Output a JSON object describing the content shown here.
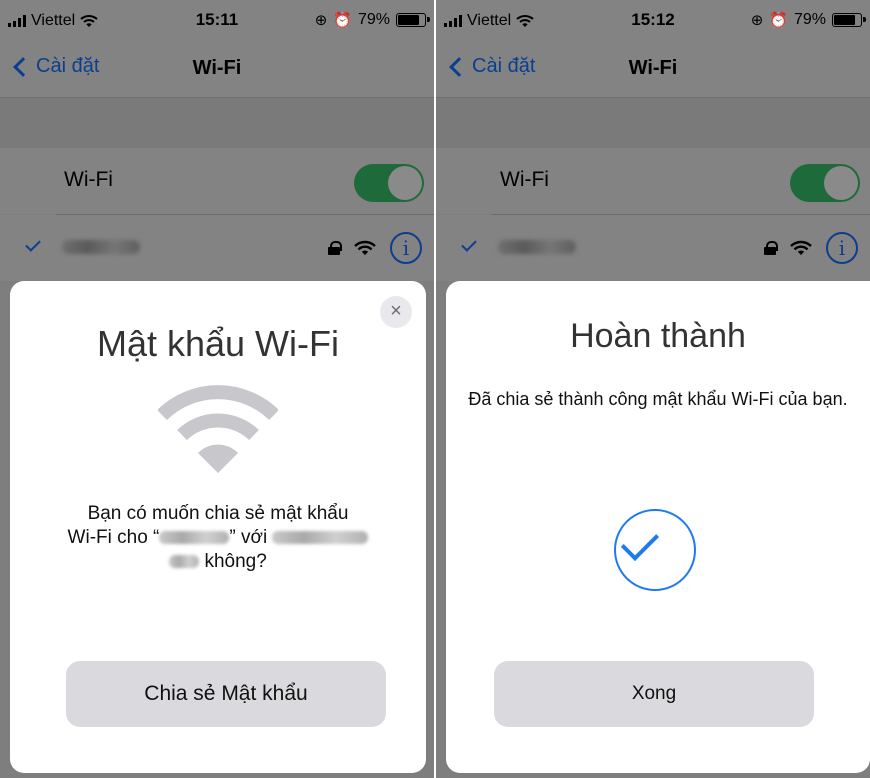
{
  "left": {
    "status": {
      "carrier": "Viettel",
      "time": "15:11",
      "battery": "79%"
    },
    "nav": {
      "back_label": "Cài đặt",
      "title": "Wi-Fi"
    },
    "wifi_row": {
      "label": "Wi-Fi",
      "toggle_on": true
    },
    "network_row": {
      "icon_lock": "lock-icon",
      "icon_wifi": "wifi-icon",
      "info_glyph": "i"
    },
    "sheet": {
      "close_glyph": "×",
      "heading": "Mật khẩu Wi-Fi",
      "body_line1": "Bạn có muốn chia sẻ mật khẩu",
      "body_line2_prefix": "Wi-Fi cho “",
      "body_line2_mid": "” với",
      "body_line3_suffix": "không?",
      "button_label": "Chia sẻ Mật khẩu"
    }
  },
  "right": {
    "status": {
      "carrier": "Viettel",
      "time": "15:12",
      "battery": "79%"
    },
    "nav": {
      "back_label": "Cài đặt",
      "title": "Wi-Fi"
    },
    "wifi_row": {
      "label": "Wi-Fi",
      "toggle_on": true
    },
    "network_row": {
      "icon_lock": "lock-icon",
      "icon_wifi": "wifi-icon",
      "info_glyph": "i"
    },
    "sheet": {
      "heading": "Hoàn thành",
      "body": "Đã chia sẻ thành công mật khẩu Wi-Fi của bạn.",
      "button_label": "Xong"
    }
  },
  "colors": {
    "accent": "#1e7bef",
    "toggle_on": "#1f6a3a",
    "sheet_button": "#d9d9de"
  }
}
